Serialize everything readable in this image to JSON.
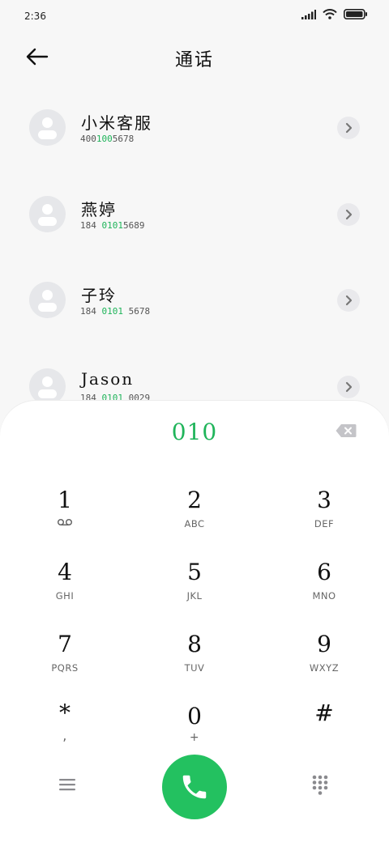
{
  "status_bar": {
    "time": "2:36"
  },
  "header": {
    "title": "通话"
  },
  "contacts": [
    {
      "name": "小米客服",
      "number_parts": [
        "400",
        "100",
        "5678"
      ]
    },
    {
      "name": "燕婷",
      "number_parts": [
        "184 ",
        "0101",
        "5689"
      ]
    },
    {
      "name": "子玲",
      "number_parts": [
        "184 ",
        "0101",
        " 5678"
      ]
    },
    {
      "name": "Jason",
      "number_parts": [
        "184 ",
        "0101",
        " 0029"
      ]
    }
  ],
  "dialpad": {
    "dialed_number": "010",
    "keys": [
      {
        "digit": "1",
        "letters": ""
      },
      {
        "digit": "2",
        "letters": "ABC"
      },
      {
        "digit": "3",
        "letters": "DEF"
      },
      {
        "digit": "4",
        "letters": "GHI"
      },
      {
        "digit": "5",
        "letters": "JKL"
      },
      {
        "digit": "6",
        "letters": "MNO"
      },
      {
        "digit": "7",
        "letters": "PQRS"
      },
      {
        "digit": "8",
        "letters": "TUV"
      },
      {
        "digit": "9",
        "letters": "WXYZ"
      },
      {
        "digit": "*",
        "letters": ","
      },
      {
        "digit": "0",
        "letters": "+"
      },
      {
        "digit": "#",
        "letters": ""
      }
    ]
  },
  "icons": {
    "signal": "signal-icon",
    "wifi": "wifi-icon",
    "battery": "battery-icon",
    "back": "back-arrow-icon",
    "chevron": "chevron-right-icon",
    "backspace": "backspace-icon",
    "voicemail": "voicemail-icon",
    "menu": "menu-icon",
    "phone": "phone-icon",
    "keypad": "keypad-icon"
  },
  "colors": {
    "accent": "#23c160",
    "highlight": "#1fb45a",
    "background": "#f7f7f7"
  }
}
